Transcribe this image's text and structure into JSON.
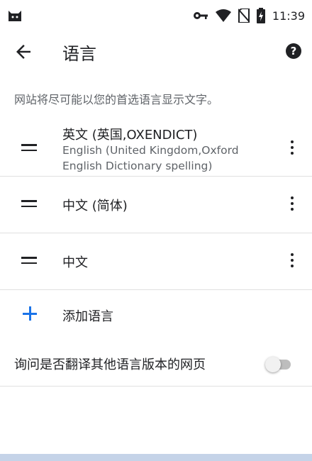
{
  "status_bar": {
    "time": "11:39",
    "icons": [
      "android-cat-icon",
      "key-icon",
      "wifi-icon",
      "no-sim-icon",
      "battery-charging-icon"
    ]
  },
  "app_bar": {
    "title": "语言",
    "back_icon": "arrow-back-icon",
    "help_icon": "help-icon"
  },
  "description": "网站将尽可能以您的首选语言显示文字。",
  "languages": [
    {
      "name": "英文 (英国,OXENDICT)",
      "sub_line1": "English (United Kingdom,Oxford",
      "sub_line2": "English Dictionary spelling)"
    },
    {
      "name": "中文 (简体)"
    },
    {
      "name": "中文"
    }
  ],
  "add_language": {
    "label": "添加语言",
    "accent": "#1a73e8"
  },
  "translate_toggle": {
    "label": "询问是否翻译其他语言版本的网页",
    "enabled": false
  }
}
